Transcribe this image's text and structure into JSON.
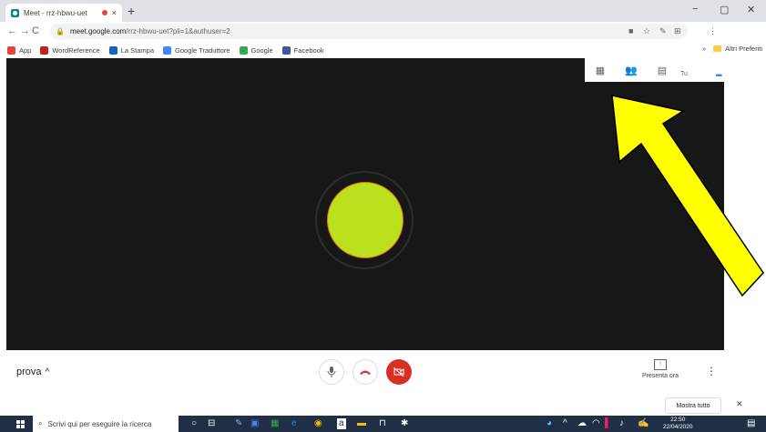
{
  "browser": {
    "tab_title": "Meet - rrz-hbwu-uet",
    "tab_close": "×",
    "new_tab": "+",
    "window_controls": [
      "−",
      "▢",
      "✕"
    ],
    "nav": {
      "back": "←",
      "forward": "→",
      "reload": "C",
      "home": "⌂"
    },
    "url_host": "meet.google.com",
    "url_path": "/rrz-hbwu-uet?pli=1&authuser=2",
    "bookmarks": [
      {
        "label": "App",
        "color": "#ea4335"
      },
      {
        "label": "WordReference",
        "color": "#c5221f"
      },
      {
        "label": "La Stampa",
        "color": "#1565c0"
      },
      {
        "label": "Google Traduttore",
        "color": "#4285f4"
      },
      {
        "label": "Google",
        "color": "#34a853"
      },
      {
        "label": "Facebook",
        "color": "#3b5998"
      }
    ],
    "bookmarks_overflow": "»",
    "other_bookmarks": "Altri Preferiti"
  },
  "meet": {
    "self_label": "Tu",
    "avatar_color": "#bbe11e",
    "meeting_name": "prova",
    "present_label": "Presenta ora",
    "icons": {
      "mic": "🎙",
      "hangup": "☎",
      "camera_off": "⊘",
      "grid": "▦",
      "people": "👥",
      "chat": "▤",
      "more": "⋮"
    }
  },
  "notification": {
    "show_all": "Mostra tutto",
    "close": "✕"
  },
  "taskbar": {
    "search_placeholder": "Scrivi qui per eseguire la ricerca",
    "time": "22:50",
    "date": "22/04/2020"
  },
  "annotation": {
    "arrow_color": "#ffff00"
  }
}
